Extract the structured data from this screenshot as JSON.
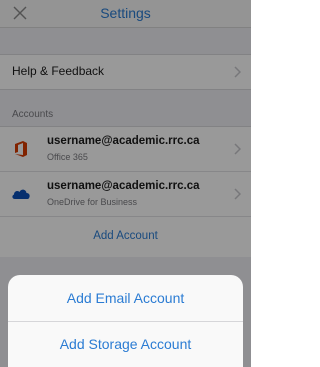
{
  "header": {
    "title": "Settings",
    "close_icon": "close-icon"
  },
  "menu": {
    "help_label": "Help & Feedback"
  },
  "accounts": {
    "section_label": "Accounts",
    "items": [
      {
        "email": "username@academic.rrc.ca",
        "service": "Office 365",
        "icon": "office-365-icon"
      },
      {
        "email": "username@academic.rrc.ca",
        "service": "OneDrive for Business",
        "icon": "onedrive-icon"
      }
    ],
    "add_label": "Add Account"
  },
  "action_sheet": {
    "email_label": "Add Email Account",
    "storage_label": "Add Storage Account"
  },
  "colors": {
    "accent": "#2b7cd3",
    "office_red": "#d83b01",
    "onedrive_blue": "#0a4fb8"
  }
}
